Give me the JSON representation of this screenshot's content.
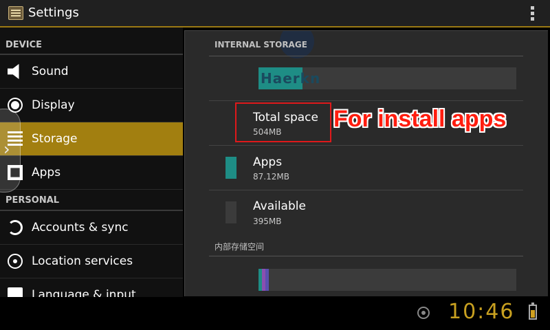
{
  "actionbar": {
    "title": "Settings"
  },
  "left": {
    "section_device": "DEVICE",
    "section_personal": "PERSONAL",
    "items": [
      {
        "label": "Sound",
        "icon": "speaker-icon"
      },
      {
        "label": "Display",
        "icon": "brightness-icon"
      },
      {
        "label": "Storage",
        "icon": "storage-icon",
        "selected": true
      },
      {
        "label": "Apps",
        "icon": "apps-icon"
      },
      {
        "label": "Accounts & sync",
        "icon": "sync-icon"
      },
      {
        "label": "Location services",
        "icon": "location-icon"
      },
      {
        "label": "Language & input",
        "icon": "language-icon"
      }
    ]
  },
  "storage": {
    "header": "INTERNAL STORAGE",
    "watermark": "Haerkn",
    "total_label": "Total space",
    "total_value": "504MB",
    "apps_label": "Apps",
    "apps_value": "87.12MB",
    "available_label": "Available",
    "available_value": "395MB",
    "section2_header": "内部存储空间",
    "apps_color": "#1e8d85",
    "available_color": "#3b3b3b",
    "usage_fraction": 0.17
  },
  "annotation": "For install apps",
  "statusbar": {
    "time": "10:46"
  },
  "colors": {
    "accent": "#a27f10",
    "highlight_box": "#e0191b",
    "annotation": "#ff1d0f"
  }
}
